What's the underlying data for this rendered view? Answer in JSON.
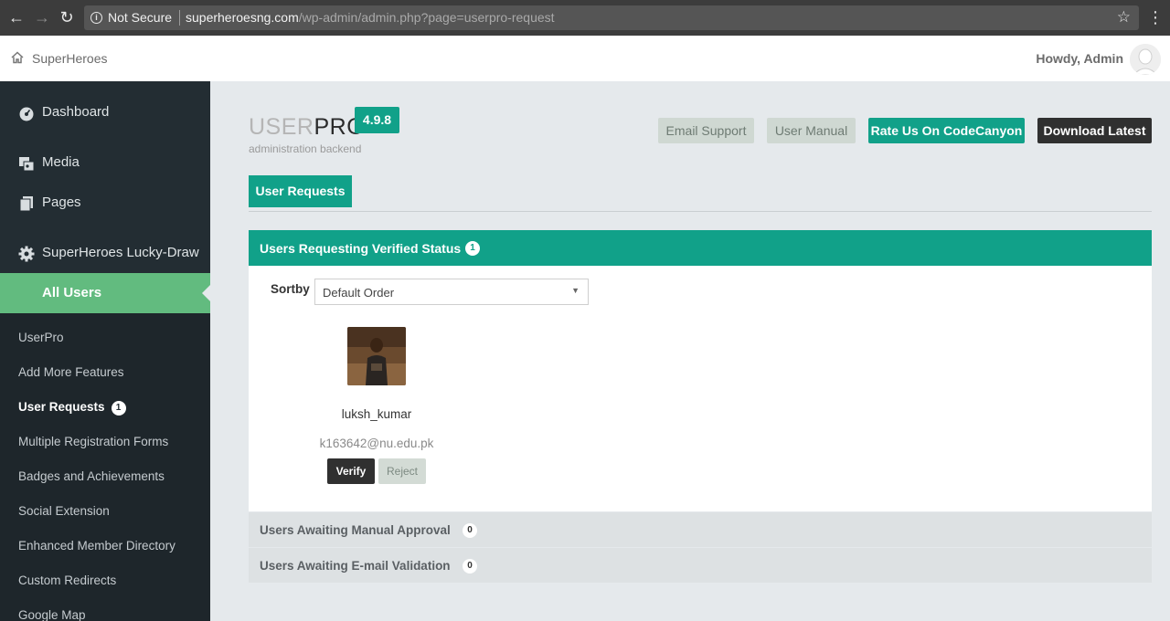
{
  "browser": {
    "security_label": "Not Secure",
    "url_host": "superheroesng.com",
    "url_path": "/wp-admin/admin.php?page=userpro-request"
  },
  "topbar": {
    "site_name": "SuperHeroes",
    "greeting": "Howdy, Admin"
  },
  "sidebar": {
    "items": [
      {
        "label": "Dashboard",
        "icon": "dashboard-icon"
      },
      {
        "label": "Media",
        "icon": "media-icon"
      },
      {
        "label": "Pages",
        "icon": "pages-icon"
      },
      {
        "label": "SuperHeroes Lucky-Draw",
        "icon": "gear-icon"
      }
    ],
    "active_item": "All Users",
    "submenu": [
      {
        "label": "UserPro"
      },
      {
        "label": "Add More Features"
      },
      {
        "label": "User Requests",
        "badge": "1"
      },
      {
        "label": "Multiple Registration Forms"
      },
      {
        "label": "Badges and Achievements"
      },
      {
        "label": "Social Extension"
      },
      {
        "label": "Enhanced Member Directory"
      },
      {
        "label": "Custom Redirects"
      },
      {
        "label": "Google Map"
      }
    ]
  },
  "header": {
    "logo_light": "USER",
    "logo_bold": "PRO",
    "version": "4.9.8",
    "subtitle": "administration backend",
    "buttons": {
      "email_support": "Email Support",
      "user_manual": "User Manual",
      "rate": "Rate Us On CodeCanyon",
      "download": "Download Latest"
    }
  },
  "tabs": {
    "active": "User Requests"
  },
  "verified_panel": {
    "title": "Users Requesting Verified Status",
    "count": "1",
    "sortby_label": "Sortby",
    "sortby_value": "Default Order",
    "user": {
      "username": "luksh_kumar",
      "email": "k163642@nu.edu.pk",
      "verify_label": "Verify",
      "reject_label": "Reject"
    }
  },
  "manual_panel": {
    "title": "Users Awaiting Manual Approval",
    "count": "0"
  },
  "email_panel": {
    "title": "Users Awaiting E-mail Validation",
    "count": "0"
  },
  "colors": {
    "accent": "#11a189",
    "sidebar": "#232d33",
    "active_menu": "#62bb7f"
  }
}
